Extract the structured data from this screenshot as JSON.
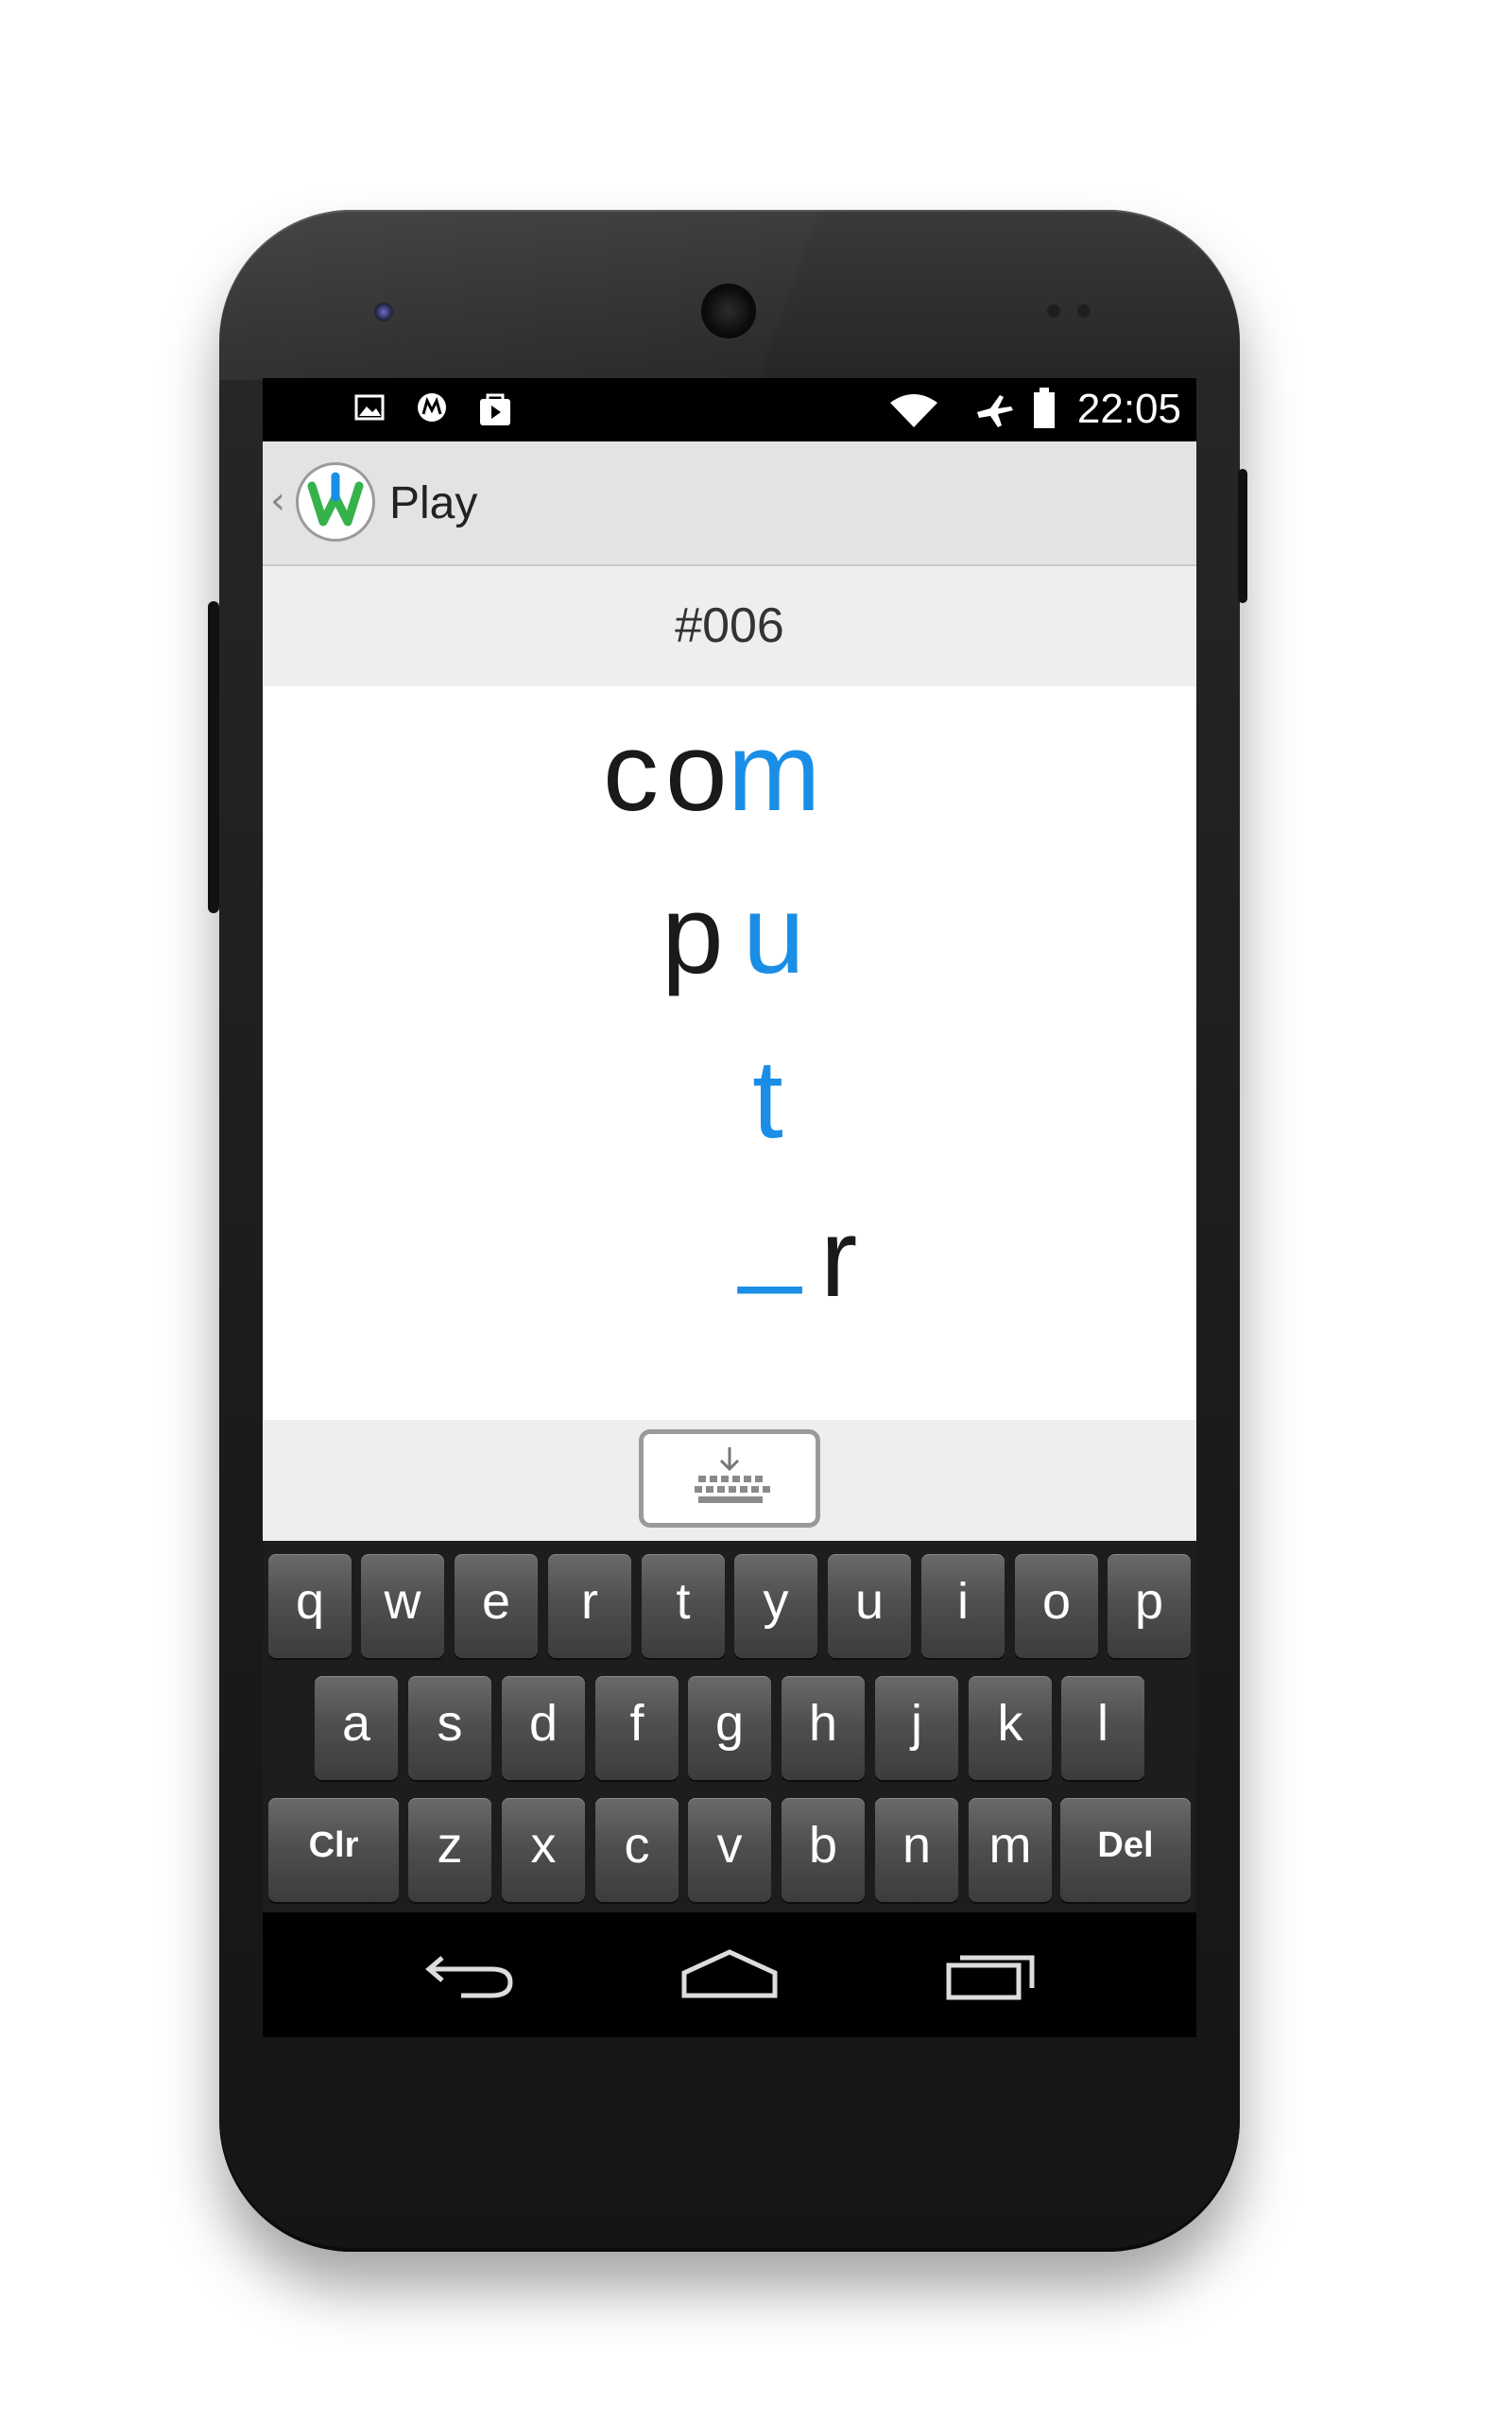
{
  "status_bar": {
    "time": "22:05",
    "left_icons": [
      "gallery-icon",
      "motorola-icon",
      "play-store-icon"
    ],
    "right_icons": [
      "wifi-icon",
      "airplane-mode-icon",
      "battery-icon"
    ]
  },
  "action_bar": {
    "title": "Play",
    "logo_letter": "W"
  },
  "puzzle": {
    "number": "#006"
  },
  "board": {
    "rows": [
      {
        "letters": [
          {
            "char": "c",
            "state": "given"
          },
          {
            "char": "o",
            "state": "given"
          },
          {
            "char": "m",
            "state": "entered"
          }
        ]
      },
      {
        "letters": [
          {
            "char": "p",
            "state": "given"
          },
          {
            "char": "u",
            "state": "entered"
          }
        ]
      },
      {
        "letters": [
          {
            "char": "t",
            "state": "entered"
          }
        ]
      },
      {
        "letters": [
          {
            "char": "_",
            "state": "cursor"
          },
          {
            "char": "r",
            "state": "given"
          }
        ]
      }
    ]
  },
  "keyboard": {
    "toggle_icon": "keyboard-hide-icon",
    "rows": [
      [
        "q",
        "w",
        "e",
        "r",
        "t",
        "y",
        "u",
        "i",
        "o",
        "p"
      ],
      [
        "a",
        "s",
        "d",
        "f",
        "g",
        "h",
        "j",
        "k",
        "l"
      ],
      [
        "Clr",
        "z",
        "x",
        "c",
        "v",
        "b",
        "n",
        "m",
        "Del"
      ]
    ]
  },
  "nav_bar": {
    "buttons": [
      "back-icon",
      "home-icon",
      "recents-icon"
    ]
  },
  "colors": {
    "accent": "#1a8ee6",
    "text": "#1a1a1a",
    "action_bar": "#e3e3e3"
  }
}
